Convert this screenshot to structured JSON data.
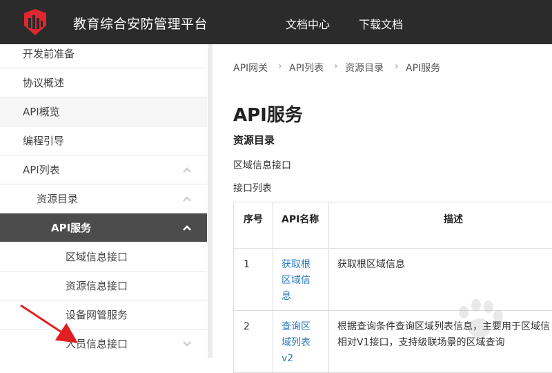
{
  "header": {
    "app_title": "教育综合安防管理平台",
    "nav": [
      "文档中心",
      "下载文档"
    ]
  },
  "sidebar": {
    "items": [
      {
        "label": "开发前准备"
      },
      {
        "label": "协议概述"
      },
      {
        "label": "API概览"
      },
      {
        "label": "编程引导"
      },
      {
        "label": "API列表"
      },
      {
        "label": "资源目录"
      },
      {
        "label": "API服务"
      },
      {
        "label": "区域信息接口"
      },
      {
        "label": "资源信息接口"
      },
      {
        "label": "设备网管服务"
      },
      {
        "label": "人员信息接口"
      }
    ]
  },
  "breadcrumb": [
    "API网关",
    "API列表",
    "资源目录",
    "API服务"
  ],
  "main": {
    "title": "API服务",
    "section": "资源目录",
    "sub1": "区域信息接口",
    "sub2": "接口列表",
    "table": {
      "headers": [
        "序号",
        "API名称",
        "描述"
      ],
      "rows": [
        {
          "no": "1",
          "name_l1": "获取根",
          "name_l2": "区域信",
          "name_l3": "息",
          "desc_l1": "获取根区域信息",
          "desc_l2": ""
        },
        {
          "no": "2",
          "name_l1": "查询区",
          "name_l2": "域列表",
          "name_l3": "v2",
          "desc_l1": "根据查询条件查询区域列表信息，主要用于区域信",
          "desc_l2": "相对V1接口，支持级联场景的区域查询"
        }
      ]
    }
  },
  "colors": {
    "topbar": "#2b2b2b",
    "logo_red": "#e0262e",
    "link": "#2b7bc2",
    "active_bg": "#4c4c4c",
    "arrow": "#e02020"
  }
}
